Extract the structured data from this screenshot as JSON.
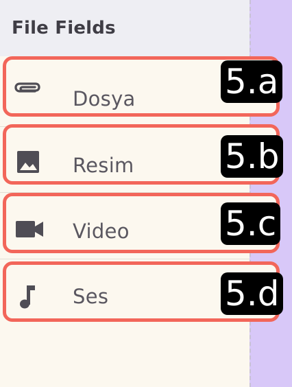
{
  "header": {
    "title": "File Fields"
  },
  "items": [
    {
      "label": "Dosya",
      "icon": "paperclip-icon",
      "badge": "5.a"
    },
    {
      "label": "Resim",
      "icon": "image-icon",
      "badge": "5.b"
    },
    {
      "label": "Video",
      "icon": "video-camera-icon",
      "badge": "5.c"
    },
    {
      "label": "Ses",
      "icon": "music-note-icon",
      "badge": "5.d"
    }
  ],
  "colors": {
    "highlight_border": "#f2665a",
    "panel_background": "#fcf8ef",
    "header_background": "#eeeef3",
    "right_strip": "#d8c8f8",
    "badge_background": "#000000",
    "badge_text": "#ffffff",
    "label_text": "#5a5760",
    "icon_color": "#4f4d55"
  }
}
